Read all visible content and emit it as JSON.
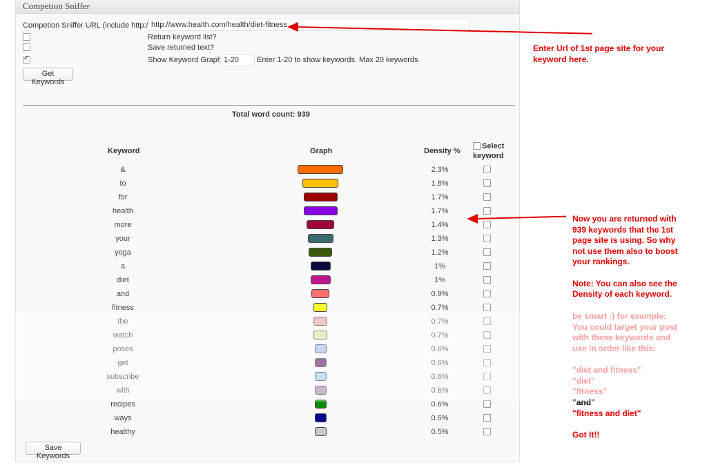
{
  "panel": {
    "title": "Competion Sniffer"
  },
  "form": {
    "url_label": "Competion Sniffer URL (include http://)",
    "url_value": "http://www.health.com/health/diet-fitness",
    "return_list_label": "Return keyword list?",
    "save_text_label": "Save returned text?",
    "show_graph_label": "Show Keyword Graph",
    "graph_range_value": "1-20",
    "graph_hint": "Enter 1-20 to show keywords. Max 20 keywords",
    "get_keywords_label": "Get Keywords",
    "return_list_checked": false,
    "save_text_checked": false,
    "show_graph_checked": true
  },
  "results": {
    "total_word_count": "Total word count: 939",
    "headers": {
      "keyword": "Keyword",
      "graph": "Graph",
      "density": "Density %",
      "select": "Select",
      "select2": "keyword"
    },
    "save_button_label": "Save Keywords",
    "rows": [
      {
        "keyword": "&",
        "density": "2.3%",
        "value": 2.3,
        "color": "#ff6a00"
      },
      {
        "keyword": "to",
        "density": "1.8%",
        "value": 1.8,
        "color": "#ffc000"
      },
      {
        "keyword": "for",
        "density": "1.7%",
        "value": 1.7,
        "color": "#990000"
      },
      {
        "keyword": "health",
        "density": "1.7%",
        "value": 1.7,
        "color": "#8a00e6"
      },
      {
        "keyword": "more",
        "density": "1.4%",
        "value": 1.4,
        "color": "#a0003c"
      },
      {
        "keyword": "your",
        "density": "1.3%",
        "value": 1.3,
        "color": "#3a6b6e"
      },
      {
        "keyword": "yoga",
        "density": "1.2%",
        "value": 1.2,
        "color": "#3a5a0a"
      },
      {
        "keyword": "a",
        "density": "1%",
        "value": 1.0,
        "color": "#0a0a3c"
      },
      {
        "keyword": "diet",
        "density": "1%",
        "value": 1.0,
        "color": "#c0148c"
      },
      {
        "keyword": "and",
        "density": "0.9%",
        "value": 0.9,
        "color": "#ff6e6e"
      },
      {
        "keyword": "fitness",
        "density": "0.7%",
        "value": 0.7,
        "color": "#ffff30"
      },
      {
        "keyword": "the",
        "density": "0.7%",
        "value": 0.7,
        "color": "#e8a8a8"
      },
      {
        "keyword": "watch",
        "density": "0.7%",
        "value": 0.7,
        "color": "#d8e8a0"
      },
      {
        "keyword": "poses",
        "density": "0.6%",
        "value": 0.6,
        "color": "#a8c0f0"
      },
      {
        "keyword": "get",
        "density": "0.6%",
        "value": 0.6,
        "color": "#6a2a6a"
      },
      {
        "keyword": "subscribe",
        "density": "0.6%",
        "value": 0.6,
        "color": "#a8d0e8"
      },
      {
        "keyword": "with",
        "density": "0.6%",
        "value": 0.6,
        "color": "#b090b0"
      },
      {
        "keyword": "recipes",
        "density": "0.6%",
        "value": 0.6,
        "color": "#008c00"
      },
      {
        "keyword": "ways",
        "density": "0.5%",
        "value": 0.5,
        "color": "#000090"
      },
      {
        "keyword": "healthy",
        "density": "0.5%",
        "value": 0.5,
        "color": "#c8c8c8"
      }
    ]
  },
  "annotations": {
    "top_note": [
      "Enter Url of 1st page site for your",
      "keyword here."
    ],
    "mid_note": [
      "Now you are returned with",
      "939 keywords that the 1st",
      "page site is using. So why",
      "not use them also to boost",
      "your rankings."
    ],
    "density_note": [
      "Note: You can also see the",
      "Density of each keyword."
    ],
    "tip_note": [
      "be smart :) for example:",
      "You could target your post",
      "with these keywords and",
      "use in order like this:"
    ],
    "examples": [
      "\"diet and fitness\"",
      "\"diet\"",
      "\"fitness\""
    ],
    "examples_dark": [
      "\"and\""
    ],
    "example_last": "\"fitness and diet\"",
    "closing": "Got It!!"
  }
}
